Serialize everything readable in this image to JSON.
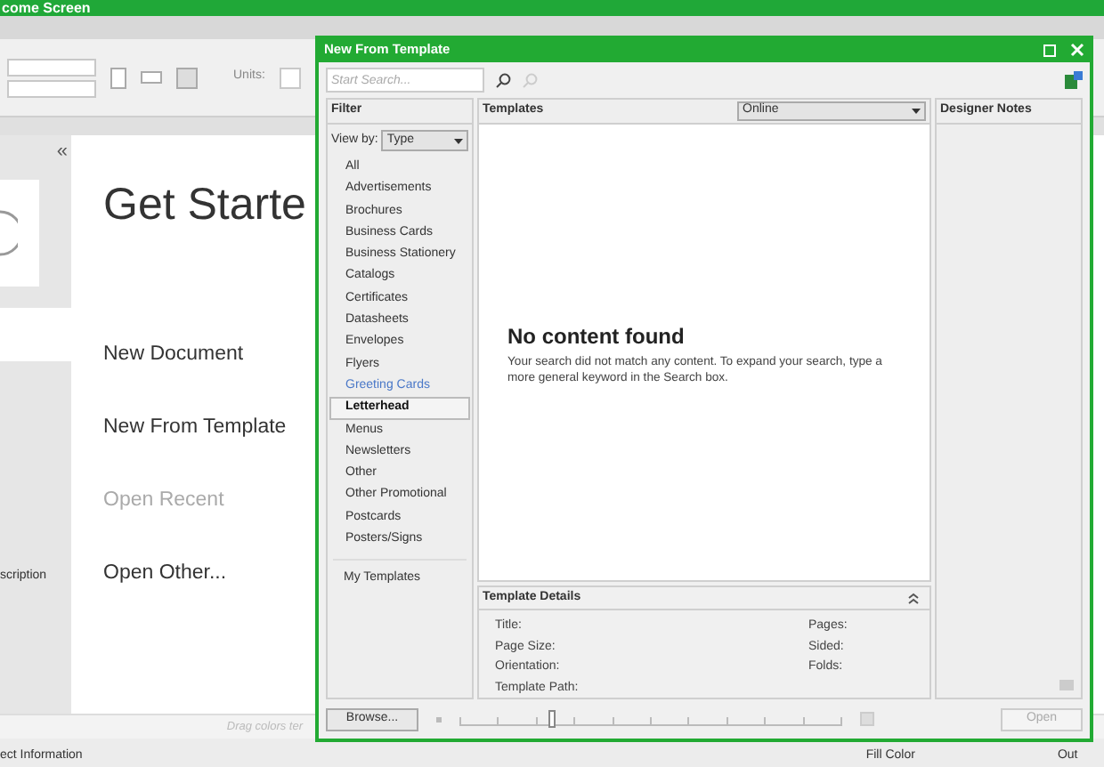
{
  "app": {
    "title": "come Screen",
    "units_label": "Units:",
    "collapse_glyph": "«",
    "heading": "Get Starte",
    "actions": [
      {
        "label": "New Document",
        "disabled": false
      },
      {
        "label": "New From Template",
        "disabled": false
      },
      {
        "label": "Open Recent",
        "disabled": true
      },
      {
        "label": "Open Other...",
        "disabled": false
      }
    ],
    "side_text": "scription",
    "hint": "Drag colors ter",
    "status_left": "ect Information",
    "status_fill": "Fill Color",
    "status_right": "Out"
  },
  "dialog": {
    "title": "New From Template",
    "search": {
      "placeholder": "Start Search..."
    },
    "filter": {
      "title": "Filter",
      "view_by_label": "View by:",
      "view_by_value": "Type",
      "items": [
        {
          "label": "All",
          "selected": false,
          "hovered": false
        },
        {
          "label": "Advertisements",
          "selected": false,
          "hovered": false
        },
        {
          "label": "Brochures",
          "selected": false,
          "hovered": false
        },
        {
          "label": "Business Cards",
          "selected": false,
          "hovered": false
        },
        {
          "label": "Business Stationery",
          "selected": false,
          "hovered": false
        },
        {
          "label": "Catalogs",
          "selected": false,
          "hovered": false
        },
        {
          "label": "Certificates",
          "selected": false,
          "hovered": false
        },
        {
          "label": "Datasheets",
          "selected": false,
          "hovered": false
        },
        {
          "label": "Envelopes",
          "selected": false,
          "hovered": false
        },
        {
          "label": "Flyers",
          "selected": false,
          "hovered": false
        },
        {
          "label": "Greeting Cards",
          "selected": false,
          "hovered": true
        },
        {
          "label": "Letterhead",
          "selected": true,
          "hovered": false
        },
        {
          "label": "Menus",
          "selected": false,
          "hovered": false
        },
        {
          "label": "Newsletters",
          "selected": false,
          "hovered": false
        },
        {
          "label": "Other",
          "selected": false,
          "hovered": false
        },
        {
          "label": "Other Promotional",
          "selected": false,
          "hovered": false
        },
        {
          "label": "Postcards",
          "selected": false,
          "hovered": false
        },
        {
          "label": "Posters/Signs",
          "selected": false,
          "hovered": false
        }
      ],
      "my_templates": "My Templates"
    },
    "templates": {
      "title": "Templates",
      "source": "Online",
      "empty_title": "No content found",
      "empty_text": "Your search did not match any content.  To expand your search, type a more general keyword in the Search box."
    },
    "details": {
      "title": "Template Details",
      "left_fields": [
        "Title:",
        "Page Size:",
        "Orientation:",
        "Template Path:"
      ],
      "right_fields": [
        "Pages:",
        "Sided:",
        "Folds:"
      ]
    },
    "designer_notes": {
      "title": "Designer Notes"
    },
    "browse_button": "Browse...",
    "zoom": {
      "level": 0.24
    },
    "open_button": {
      "label": "Open",
      "disabled": true
    }
  }
}
